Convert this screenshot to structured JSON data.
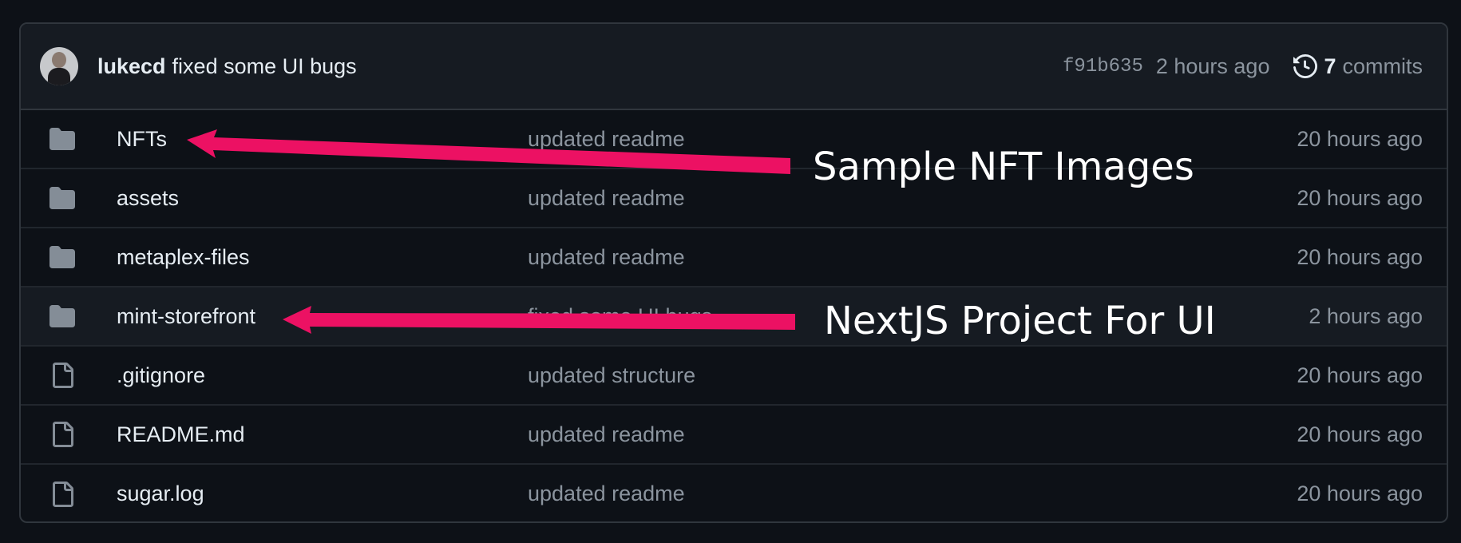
{
  "latest_commit": {
    "author": "lukecd",
    "message": "fixed some UI bugs",
    "sha": "f91b635",
    "time": "2 hours ago",
    "commits_count": "7",
    "commits_label": "commits"
  },
  "files": [
    {
      "name": "NFTs",
      "type": "folder",
      "icon": "folder-icon",
      "commit_message": "updated readme",
      "age": "20 hours ago"
    },
    {
      "name": "assets",
      "type": "folder",
      "icon": "folder-icon",
      "commit_message": "updated readme",
      "age": "20 hours ago"
    },
    {
      "name": "metaplex-files",
      "type": "folder",
      "icon": "folder-icon",
      "commit_message": "updated readme",
      "age": "20 hours ago"
    },
    {
      "name": "mint-storefront",
      "type": "folder",
      "icon": "folder-icon",
      "commit_message": "fixed some UI bugs",
      "age": "2 hours ago"
    },
    {
      "name": ".gitignore",
      "type": "file",
      "icon": "file-icon",
      "commit_message": "updated structure",
      "age": "20 hours ago"
    },
    {
      "name": "README.md",
      "type": "file",
      "icon": "file-icon",
      "commit_message": "updated readme",
      "age": "20 hours ago"
    },
    {
      "name": "sugar.log",
      "type": "file",
      "icon": "file-icon",
      "commit_message": "updated readme",
      "age": "20 hours ago"
    }
  ],
  "annotations": [
    {
      "text": "Sample NFT Images",
      "points_to": "NFTs"
    },
    {
      "text": "NextJS Project For UI",
      "points_to": "mint-storefront"
    }
  ],
  "colors": {
    "background": "#0d1117",
    "header_bg": "#161b22",
    "border": "#30363d",
    "text_primary": "#e6edf3",
    "text_muted": "#8b949e",
    "icon": "#848d97",
    "annotation_arrow": "#ec1163"
  }
}
